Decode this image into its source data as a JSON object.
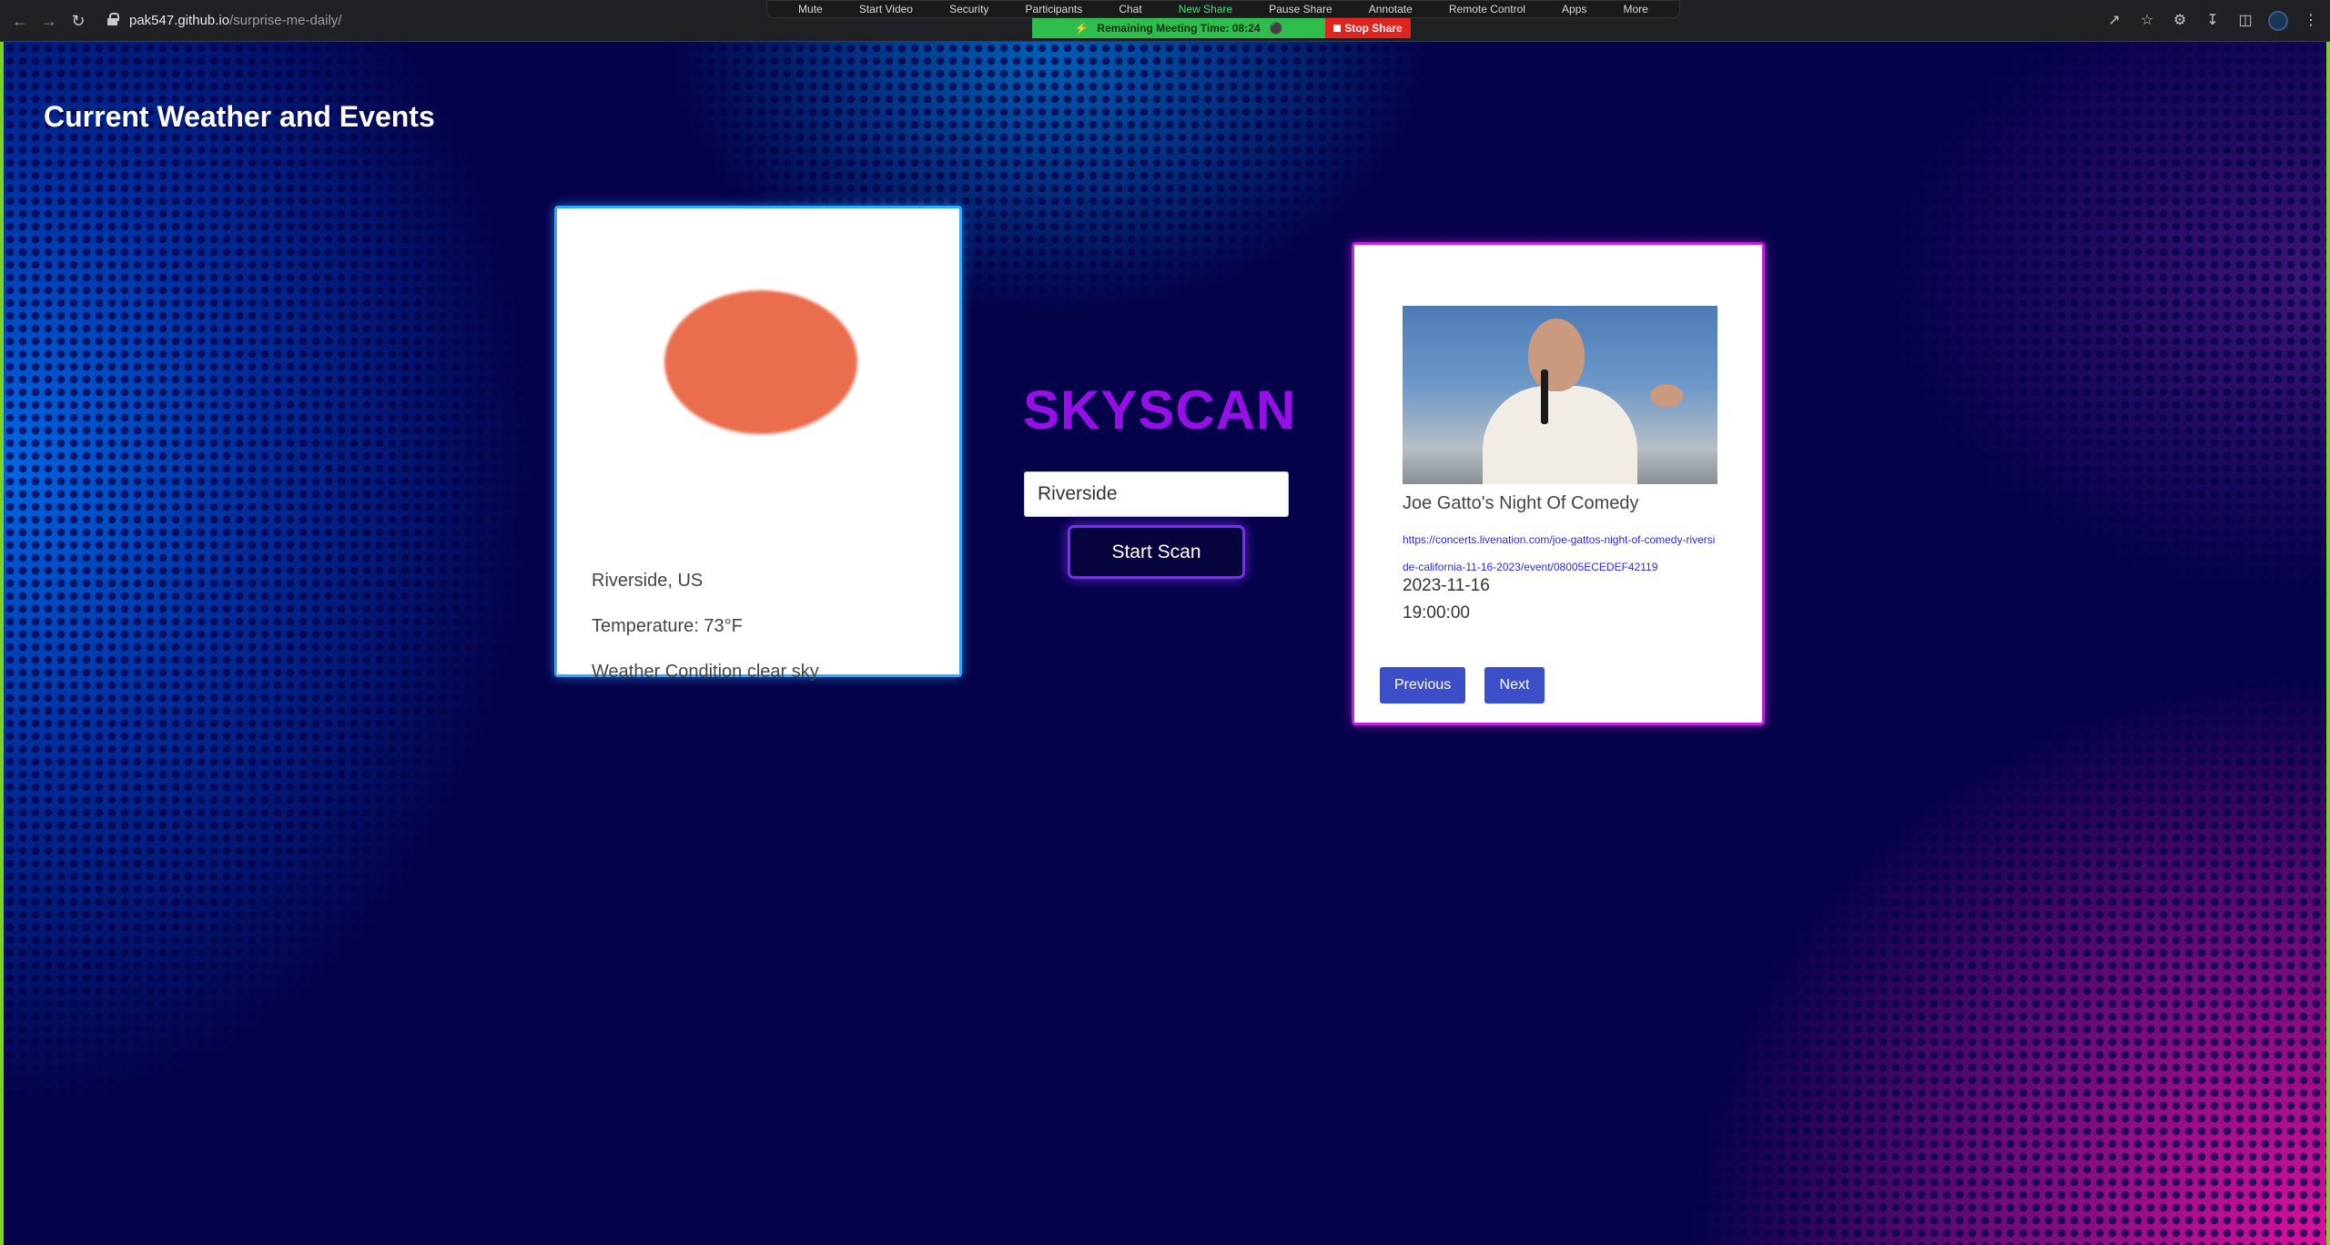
{
  "browser": {
    "url_host": "pak547.github.io",
    "url_path": "/surprise-me-daily/"
  },
  "zoom": {
    "items": [
      "Mute",
      "Start Video",
      "Security",
      "Participants",
      "Chat",
      "New Share",
      "Pause Share",
      "Annotate",
      "Remote Control",
      "Apps",
      "More"
    ],
    "timer_label": "Remaining Meeting Time: 08:24",
    "stop_share": "Stop Share"
  },
  "page": {
    "title": "Current Weather and Events"
  },
  "weather": {
    "city": "Riverside, US",
    "temperature": "Temperature: 73°F",
    "condition": "Weather Condition clear sky",
    "icon_color": "#ea6d4e"
  },
  "search": {
    "brand": "SKYSCAN",
    "value": "Riverside",
    "button_label": "Start Scan"
  },
  "event": {
    "name": "Joe Gatto's Night Of Comedy",
    "link": "https://concerts.livenation.com/joe-gattos-night-of-comedy-riverside-california-11-16-2023/event/08005ECEDEF42119",
    "date": "2023-11-16",
    "time": "19:00:00",
    "prev_label": "Previous",
    "next_label": "Next"
  },
  "colors": {
    "weather_border": "#2ea9ff",
    "event_border": "#c21ee0",
    "brand": "#9410e6",
    "button_blue": "#3c4fc8"
  }
}
